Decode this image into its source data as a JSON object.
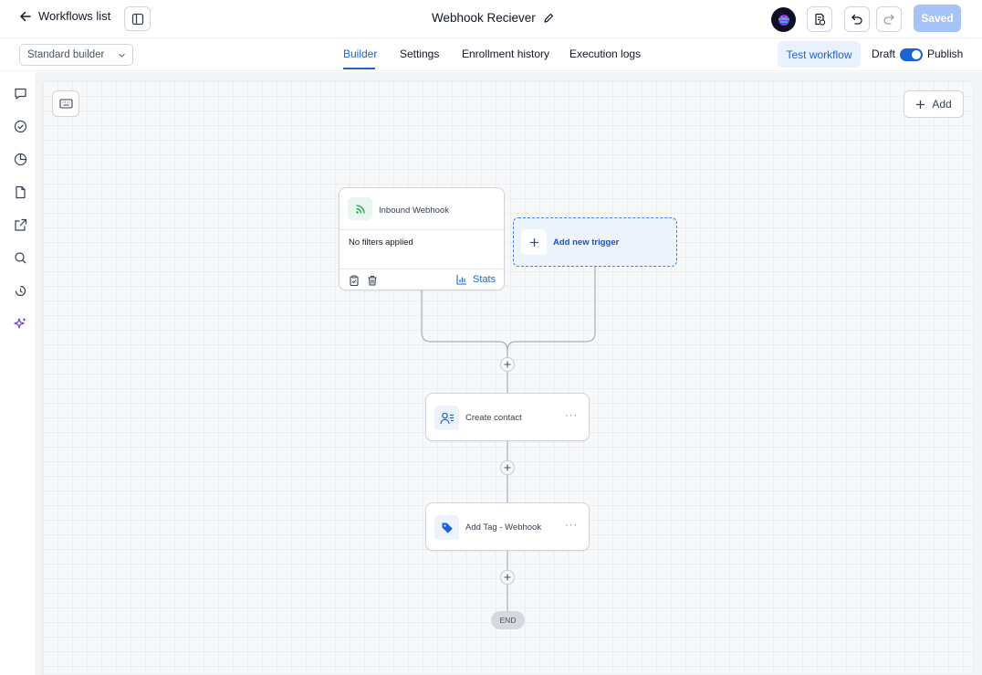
{
  "header": {
    "back_label": "Workflows list",
    "workflow_title": "Webhook Reciever",
    "saved_label": "Saved"
  },
  "subheader": {
    "builder_select_value": "Standard builder",
    "tabs": [
      {
        "label": "Builder",
        "active": true
      },
      {
        "label": "Settings",
        "active": false
      },
      {
        "label": "Enrollment history",
        "active": false
      },
      {
        "label": "Execution logs",
        "active": false
      }
    ],
    "test_workflow_label": "Test workflow",
    "draft_label": "Draft",
    "publish_label": "Publish",
    "publish_toggle_on": true
  },
  "rail": {
    "icons": [
      "chat-icon",
      "check-circle-icon",
      "pie-chart-icon",
      "document-icon",
      "external-link-icon",
      "search-icon",
      "history-icon",
      "sparkle-icon"
    ]
  },
  "canvas": {
    "add_label": "Add",
    "trigger": {
      "title": "Inbound Webhook",
      "filter_text": "No filters applied",
      "stats_label": "Stats"
    },
    "new_trigger_label": "Add new trigger",
    "actions": [
      {
        "label": "Create contact",
        "icon": "contact-icon"
      },
      {
        "label": "Add Tag - Webhook",
        "icon": "tag-icon"
      }
    ],
    "end_label": "END"
  },
  "colors": {
    "accent": "#1d63d8",
    "saved_bg": "#a5c3f7",
    "trigger_icon_bg": "#e8f6ee",
    "sparkle": "#6d3fd1"
  }
}
